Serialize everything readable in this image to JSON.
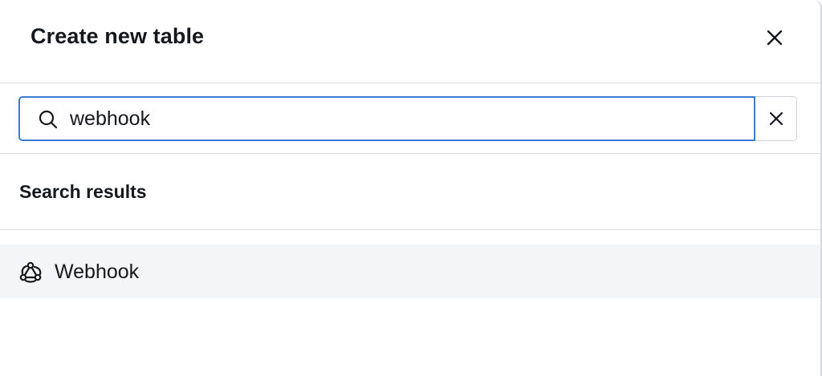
{
  "dialog": {
    "title": "Create new table",
    "close_icon": "close-icon"
  },
  "search": {
    "value": "webhook",
    "placeholder": "",
    "search_icon": "search-icon",
    "clear_icon": "close-icon"
  },
  "results": {
    "heading": "Search results",
    "items": [
      {
        "label": "Webhook",
        "icon": "webhook-icon"
      }
    ]
  },
  "colors": {
    "focus_border": "#3d7bd4",
    "divider": "#d9dce1",
    "row_highlight": "#f4f5f7",
    "text": "#15181c"
  }
}
